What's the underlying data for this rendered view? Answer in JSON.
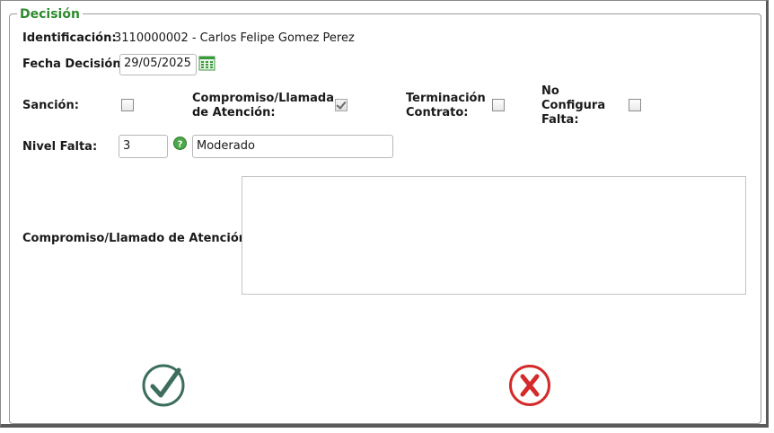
{
  "fieldset": {
    "legend": "Decisión"
  },
  "identificacion": {
    "label": "Identificación:",
    "value": "3110000002 - Carlos Felipe Gomez Perez"
  },
  "fecha_decision": {
    "label": "Fecha Decisión:",
    "value": "29/05/2025",
    "icon": "calendar-icon"
  },
  "checks": {
    "sancion": {
      "label": "Sanción:",
      "checked": false
    },
    "compromiso": {
      "label_line1": "Compromiso/Llamada",
      "label_line2": "de Atención:",
      "checked": true,
      "disabled": true
    },
    "terminacion": {
      "label_line1": "Terminación",
      "label_line2": "Contrato:",
      "checked": false
    },
    "no_configura": {
      "label_line1": "No",
      "label_line2": "Configura",
      "label_line3": "Falta:",
      "checked": false
    }
  },
  "nivel_falta": {
    "label": "Nivel Falta:",
    "code": "3",
    "description": "Moderado",
    "icon": "help-icon"
  },
  "compromiso_text": {
    "label": "Compromiso/Llamado de Atención:",
    "value": ""
  },
  "actions": {
    "accept_icon": "checkmark-icon",
    "cancel_icon": "x-icon"
  },
  "colors": {
    "legend": "#2e8b2e",
    "accept": "#3d6e5c",
    "cancel": "#d42a2a",
    "calendar": "#3c9a3c"
  }
}
